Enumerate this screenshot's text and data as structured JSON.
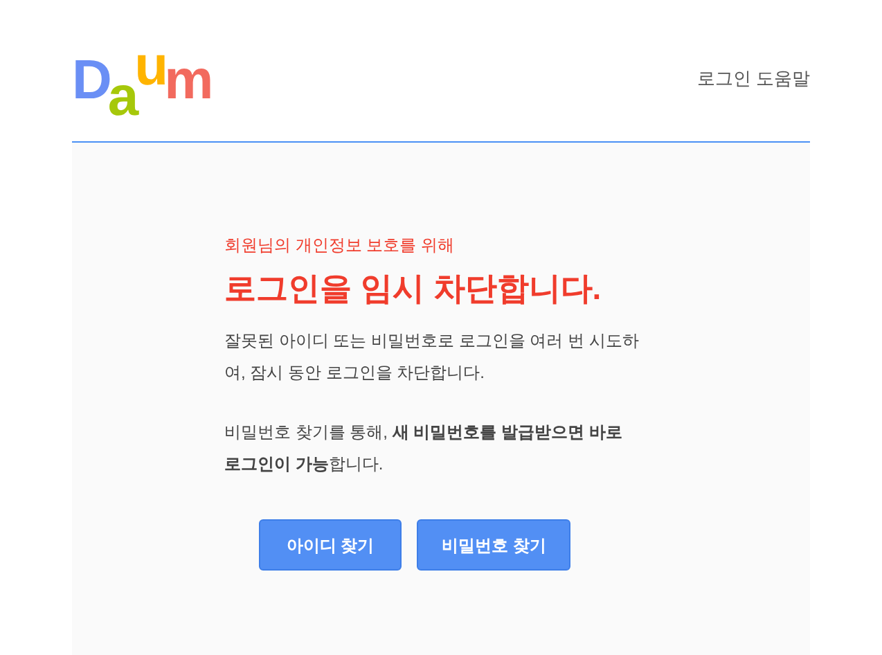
{
  "logo": {
    "letters": [
      {
        "text": "D",
        "color": "#6a8ff5"
      },
      {
        "text": "a",
        "color": "#a6c80a"
      },
      {
        "text": "u",
        "color": "#ffb400"
      },
      {
        "text": "m",
        "color": "#f26a5e"
      }
    ]
  },
  "header": {
    "help_link": "로그인 도움말"
  },
  "notice": {
    "subtitle": "회원님의 개인정보 보호를 위해",
    "title": "로그인을 임시 차단합니다.",
    "paragraphs": [
      "잘못된 아이디 또는 비밀번호로 로그인을 여러 번 시도하여, 잠시 동안 로그인을 차단합니다.",
      "비밀번호 찾기를 통해, **새 비밀번호를 발급받으면 바로 로그인이 가능**합니다."
    ]
  },
  "buttons": [
    "아이디 찾기",
    "비밀번호 찾기"
  ]
}
